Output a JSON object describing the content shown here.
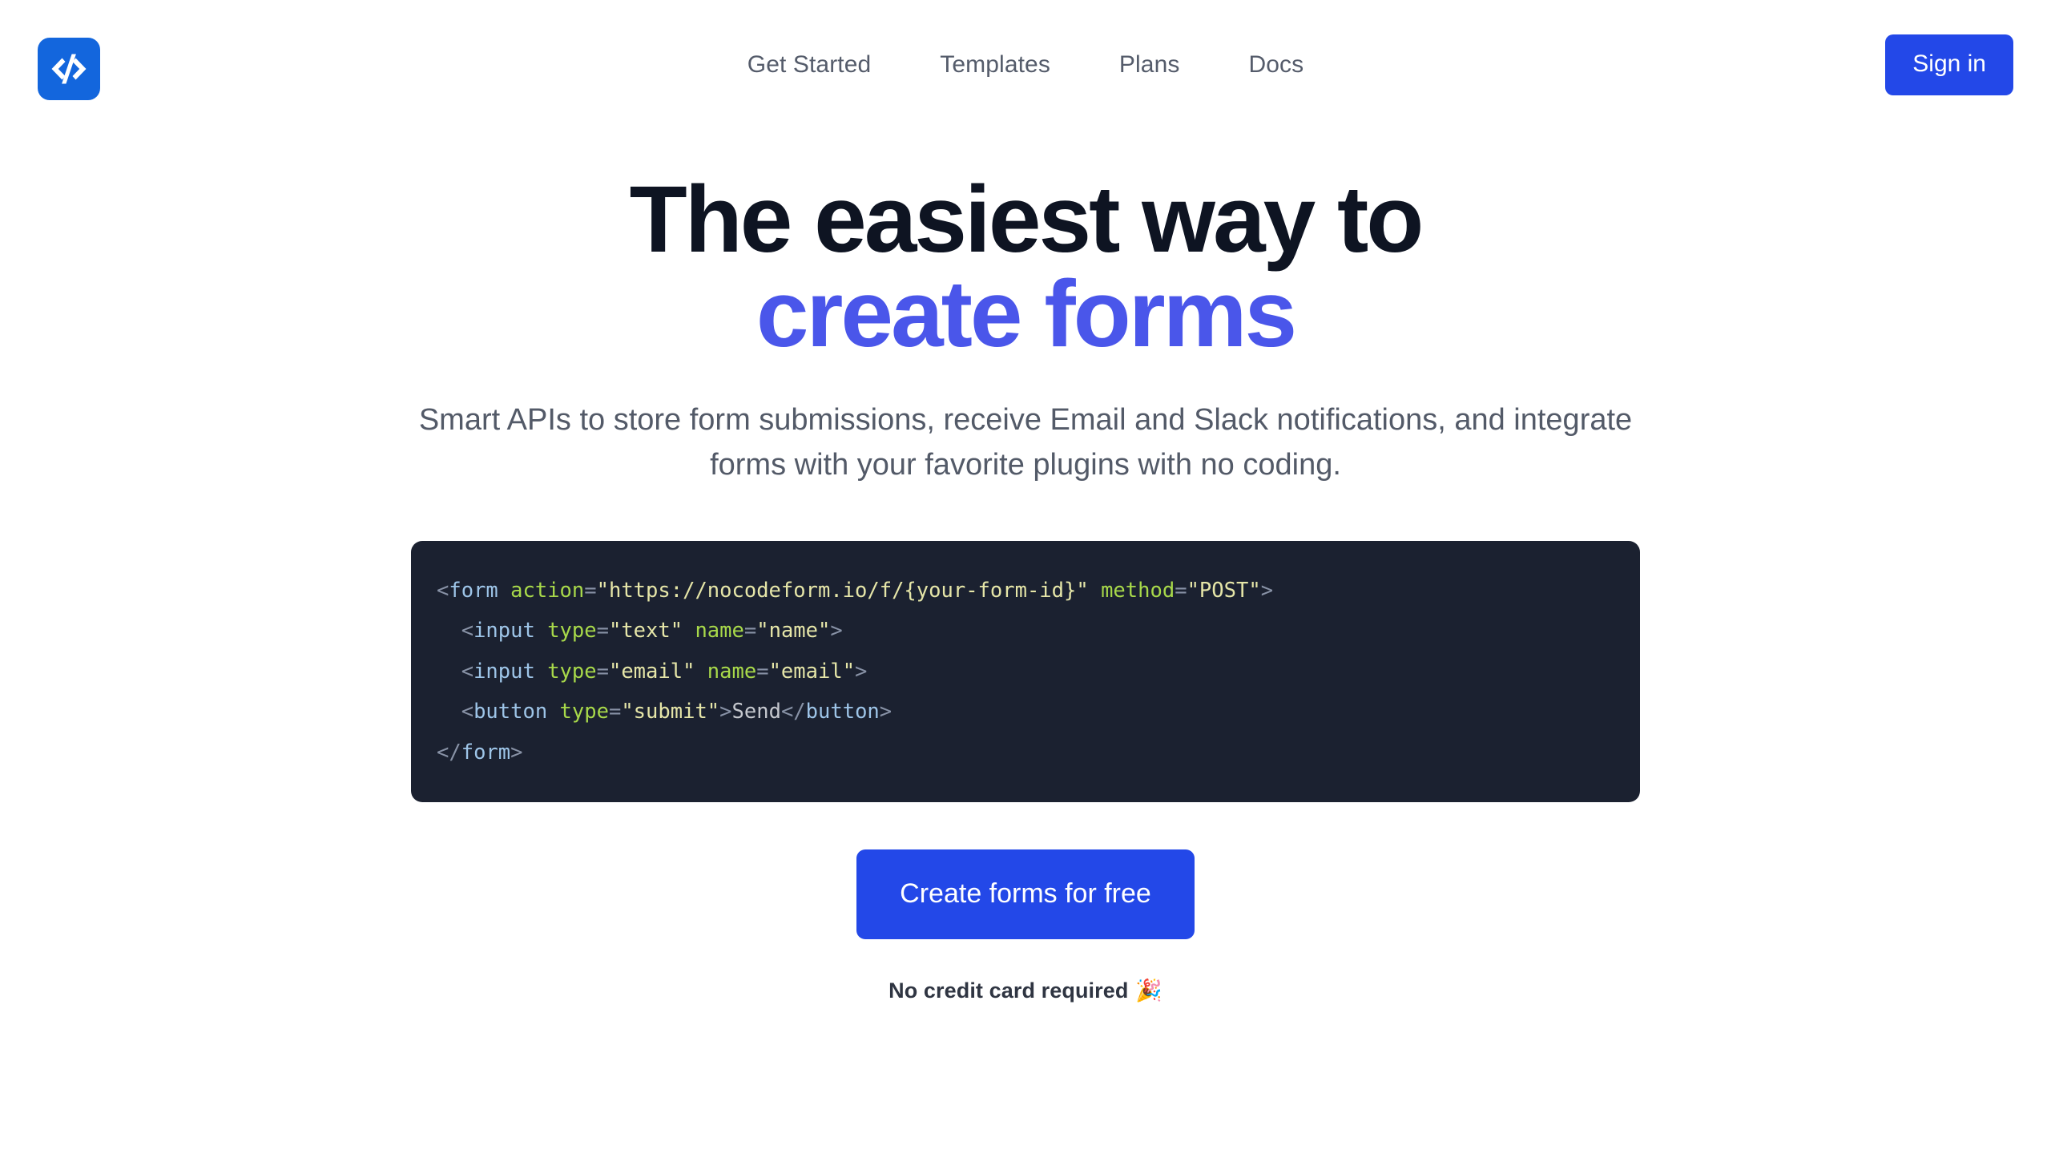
{
  "brand": {
    "logo_icon": "code-brackets-icon",
    "logo_color": "#1366dd"
  },
  "header": {
    "nav_items": [
      {
        "label": "Get Started"
      },
      {
        "label": "Templates"
      },
      {
        "label": "Plans"
      },
      {
        "label": "Docs"
      }
    ],
    "signin_label": "Sign in",
    "signin_color": "#2348e8"
  },
  "hero": {
    "title_line_1": "The easiest way to",
    "title_line_2": "create forms",
    "title_color": "#0e1422",
    "title_accent_color": "#4a56ea",
    "subtitle": "Smart APIs to store form submissions, receive Email and Slack notifications, and integrate forms with your favorite plugins with no coding."
  },
  "code_sample": {
    "background": "#1b2130",
    "language": "html",
    "plain_text": "<form action=\"https://nocodeform.io/f/{your-form-id}\" method=\"POST\">\n  <input type=\"text\" name=\"name\">\n  <input type=\"email\" name=\"email\">\n  <button type=\"submit\">Send</button>\n</form>",
    "lines": [
      {
        "tokens": [
          {
            "t": "punc",
            "v": "<"
          },
          {
            "t": "tag",
            "v": "form"
          },
          {
            "t": "punc",
            "v": " "
          },
          {
            "t": "attr",
            "v": "action"
          },
          {
            "t": "punc",
            "v": "="
          },
          {
            "t": "val",
            "v": "\"https://nocodeform.io/f/{your-form-id}\""
          },
          {
            "t": "punc",
            "v": " "
          },
          {
            "t": "attr",
            "v": "method"
          },
          {
            "t": "punc",
            "v": "="
          },
          {
            "t": "val",
            "v": "\"POST\""
          },
          {
            "t": "punc",
            "v": ">"
          }
        ]
      },
      {
        "tokens": [
          {
            "t": "punc",
            "v": "  <"
          },
          {
            "t": "tag",
            "v": "input"
          },
          {
            "t": "punc",
            "v": " "
          },
          {
            "t": "attr",
            "v": "type"
          },
          {
            "t": "punc",
            "v": "="
          },
          {
            "t": "val",
            "v": "\"text\""
          },
          {
            "t": "punc",
            "v": " "
          },
          {
            "t": "attr",
            "v": "name"
          },
          {
            "t": "punc",
            "v": "="
          },
          {
            "t": "val",
            "v": "\"name\""
          },
          {
            "t": "punc",
            "v": ">"
          }
        ]
      },
      {
        "tokens": [
          {
            "t": "punc",
            "v": "  <"
          },
          {
            "t": "tag",
            "v": "input"
          },
          {
            "t": "punc",
            "v": " "
          },
          {
            "t": "attr",
            "v": "type"
          },
          {
            "t": "punc",
            "v": "="
          },
          {
            "t": "val",
            "v": "\"email\""
          },
          {
            "t": "punc",
            "v": " "
          },
          {
            "t": "attr",
            "v": "name"
          },
          {
            "t": "punc",
            "v": "="
          },
          {
            "t": "val",
            "v": "\"email\""
          },
          {
            "t": "punc",
            "v": ">"
          }
        ]
      },
      {
        "tokens": [
          {
            "t": "punc",
            "v": "  <"
          },
          {
            "t": "tag",
            "v": "button"
          },
          {
            "t": "punc",
            "v": " "
          },
          {
            "t": "attr",
            "v": "type"
          },
          {
            "t": "punc",
            "v": "="
          },
          {
            "t": "val",
            "v": "\"submit\""
          },
          {
            "t": "punc",
            "v": ">"
          },
          {
            "t": "text",
            "v": "Send"
          },
          {
            "t": "punc",
            "v": "</"
          },
          {
            "t": "tag",
            "v": "button"
          },
          {
            "t": "punc",
            "v": ">"
          }
        ]
      },
      {
        "tokens": [
          {
            "t": "punc",
            "v": "</"
          },
          {
            "t": "tag",
            "v": "form"
          },
          {
            "t": "punc",
            "v": ">"
          }
        ]
      }
    ]
  },
  "cta": {
    "button_label": "Create forms for free",
    "button_color": "#2348e8",
    "note_text": "No credit card required",
    "note_emoji": "🎉"
  }
}
